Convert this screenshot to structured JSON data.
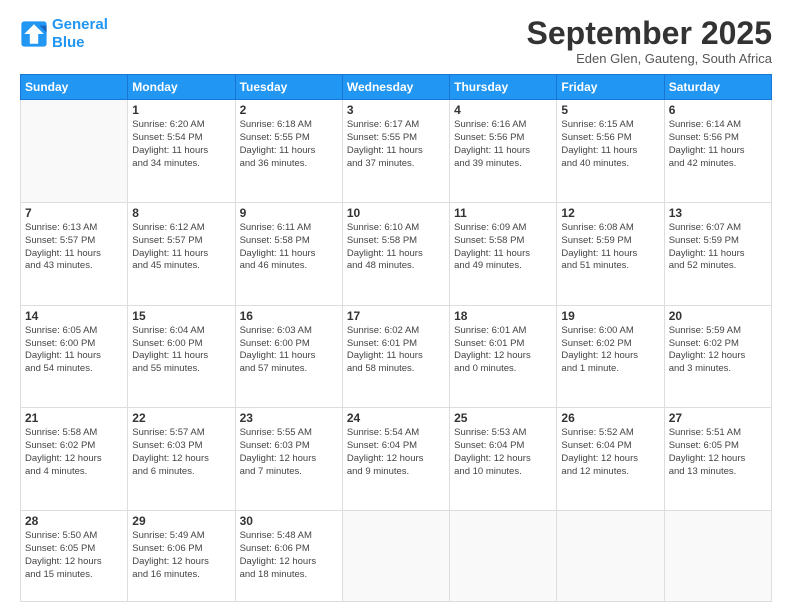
{
  "logo": {
    "line1": "General",
    "line2": "Blue"
  },
  "title": "September 2025",
  "subtitle": "Eden Glen, Gauteng, South Africa",
  "weekdays": [
    "Sunday",
    "Monday",
    "Tuesday",
    "Wednesday",
    "Thursday",
    "Friday",
    "Saturday"
  ],
  "days": [
    {
      "num": "",
      "info": ""
    },
    {
      "num": "1",
      "info": "Sunrise: 6:20 AM\nSunset: 5:54 PM\nDaylight: 11 hours\nand 34 minutes."
    },
    {
      "num": "2",
      "info": "Sunrise: 6:18 AM\nSunset: 5:55 PM\nDaylight: 11 hours\nand 36 minutes."
    },
    {
      "num": "3",
      "info": "Sunrise: 6:17 AM\nSunset: 5:55 PM\nDaylight: 11 hours\nand 37 minutes."
    },
    {
      "num": "4",
      "info": "Sunrise: 6:16 AM\nSunset: 5:56 PM\nDaylight: 11 hours\nand 39 minutes."
    },
    {
      "num": "5",
      "info": "Sunrise: 6:15 AM\nSunset: 5:56 PM\nDaylight: 11 hours\nand 40 minutes."
    },
    {
      "num": "6",
      "info": "Sunrise: 6:14 AM\nSunset: 5:56 PM\nDaylight: 11 hours\nand 42 minutes."
    },
    {
      "num": "7",
      "info": "Sunrise: 6:13 AM\nSunset: 5:57 PM\nDaylight: 11 hours\nand 43 minutes."
    },
    {
      "num": "8",
      "info": "Sunrise: 6:12 AM\nSunset: 5:57 PM\nDaylight: 11 hours\nand 45 minutes."
    },
    {
      "num": "9",
      "info": "Sunrise: 6:11 AM\nSunset: 5:58 PM\nDaylight: 11 hours\nand 46 minutes."
    },
    {
      "num": "10",
      "info": "Sunrise: 6:10 AM\nSunset: 5:58 PM\nDaylight: 11 hours\nand 48 minutes."
    },
    {
      "num": "11",
      "info": "Sunrise: 6:09 AM\nSunset: 5:58 PM\nDaylight: 11 hours\nand 49 minutes."
    },
    {
      "num": "12",
      "info": "Sunrise: 6:08 AM\nSunset: 5:59 PM\nDaylight: 11 hours\nand 51 minutes."
    },
    {
      "num": "13",
      "info": "Sunrise: 6:07 AM\nSunset: 5:59 PM\nDaylight: 11 hours\nand 52 minutes."
    },
    {
      "num": "14",
      "info": "Sunrise: 6:05 AM\nSunset: 6:00 PM\nDaylight: 11 hours\nand 54 minutes."
    },
    {
      "num": "15",
      "info": "Sunrise: 6:04 AM\nSunset: 6:00 PM\nDaylight: 11 hours\nand 55 minutes."
    },
    {
      "num": "16",
      "info": "Sunrise: 6:03 AM\nSunset: 6:00 PM\nDaylight: 11 hours\nand 57 minutes."
    },
    {
      "num": "17",
      "info": "Sunrise: 6:02 AM\nSunset: 6:01 PM\nDaylight: 11 hours\nand 58 minutes."
    },
    {
      "num": "18",
      "info": "Sunrise: 6:01 AM\nSunset: 6:01 PM\nDaylight: 12 hours\nand 0 minutes."
    },
    {
      "num": "19",
      "info": "Sunrise: 6:00 AM\nSunset: 6:02 PM\nDaylight: 12 hours\nand 1 minute."
    },
    {
      "num": "20",
      "info": "Sunrise: 5:59 AM\nSunset: 6:02 PM\nDaylight: 12 hours\nand 3 minutes."
    },
    {
      "num": "21",
      "info": "Sunrise: 5:58 AM\nSunset: 6:02 PM\nDaylight: 12 hours\nand 4 minutes."
    },
    {
      "num": "22",
      "info": "Sunrise: 5:57 AM\nSunset: 6:03 PM\nDaylight: 12 hours\nand 6 minutes."
    },
    {
      "num": "23",
      "info": "Sunrise: 5:55 AM\nSunset: 6:03 PM\nDaylight: 12 hours\nand 7 minutes."
    },
    {
      "num": "24",
      "info": "Sunrise: 5:54 AM\nSunset: 6:04 PM\nDaylight: 12 hours\nand 9 minutes."
    },
    {
      "num": "25",
      "info": "Sunrise: 5:53 AM\nSunset: 6:04 PM\nDaylight: 12 hours\nand 10 minutes."
    },
    {
      "num": "26",
      "info": "Sunrise: 5:52 AM\nSunset: 6:04 PM\nDaylight: 12 hours\nand 12 minutes."
    },
    {
      "num": "27",
      "info": "Sunrise: 5:51 AM\nSunset: 6:05 PM\nDaylight: 12 hours\nand 13 minutes."
    },
    {
      "num": "28",
      "info": "Sunrise: 5:50 AM\nSunset: 6:05 PM\nDaylight: 12 hours\nand 15 minutes."
    },
    {
      "num": "29",
      "info": "Sunrise: 5:49 AM\nSunset: 6:06 PM\nDaylight: 12 hours\nand 16 minutes."
    },
    {
      "num": "30",
      "info": "Sunrise: 5:48 AM\nSunset: 6:06 PM\nDaylight: 12 hours\nand 18 minutes."
    },
    {
      "num": "",
      "info": ""
    },
    {
      "num": "",
      "info": ""
    },
    {
      "num": "",
      "info": ""
    },
    {
      "num": "",
      "info": ""
    }
  ]
}
